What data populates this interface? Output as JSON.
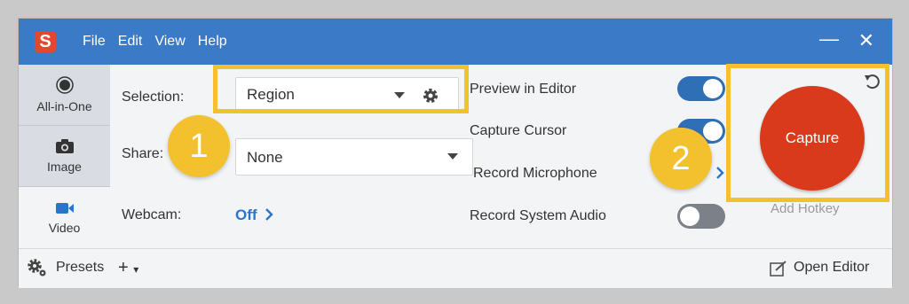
{
  "app": {
    "logo_letter": "S",
    "menu": [
      "File",
      "Edit",
      "View",
      "Help"
    ],
    "minimize": "—",
    "close": "✕"
  },
  "sidebar": {
    "items": [
      {
        "label": "All-in-One",
        "icon": "record-circle-icon"
      },
      {
        "label": "Image",
        "icon": "camera-icon"
      },
      {
        "label": "Video",
        "icon": "video-camera-icon"
      }
    ]
  },
  "settings": {
    "selection_label": "Selection:",
    "selection_value": "Region",
    "share_label": "Share:",
    "share_value": "None",
    "webcam_label": "Webcam:",
    "webcam_value": "Off"
  },
  "options": [
    {
      "label": "Preview in Editor",
      "state": "on"
    },
    {
      "label": "Capture Cursor",
      "state": "on"
    },
    {
      "label": "Record Microphone",
      "state": "on"
    },
    {
      "label": "Record System Audio",
      "state": "off"
    }
  ],
  "capture": {
    "button_label": "Capture",
    "hotkey_label": "Add Hotkey"
  },
  "footer": {
    "presets_label": "Presets",
    "add_label": "+",
    "open_editor_label": "Open Editor"
  },
  "annotations": {
    "badge1": "1",
    "badge2": "2"
  },
  "colors": {
    "titlebar": "#3b7ac6",
    "accent_link": "#2a74c9",
    "toggle_on": "#2f6fb5",
    "capture": "#d93a1c",
    "highlight": "#f4c12e"
  }
}
